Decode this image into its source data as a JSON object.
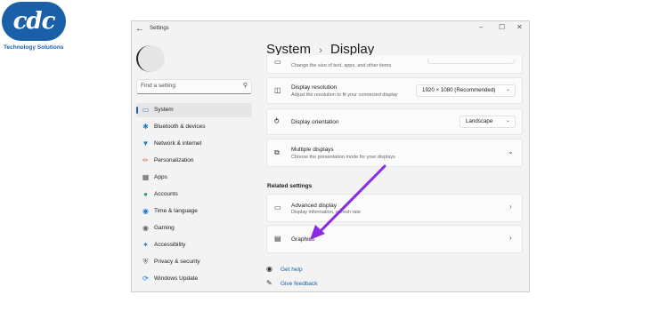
{
  "logo": {
    "mark": "cdc",
    "tagline": "Technology Solutions",
    "color": "#1a5fa8"
  },
  "window": {
    "title": "Settings",
    "controls": [
      "–",
      "☐",
      "✕"
    ]
  },
  "search": {
    "placeholder": "Find a setting",
    "icon": "search-icon"
  },
  "sidebar": {
    "items": [
      {
        "label": "System",
        "icon": "system-icon",
        "selected": true
      },
      {
        "label": "Bluetooth & devices",
        "icon": "bluetooth-icon"
      },
      {
        "label": "Network & internet",
        "icon": "network-icon"
      },
      {
        "label": "Personalization",
        "icon": "brush-icon"
      },
      {
        "label": "Apps",
        "icon": "apps-icon"
      },
      {
        "label": "Accounts",
        "icon": "accounts-icon"
      },
      {
        "label": "Time & language",
        "icon": "globe-icon"
      },
      {
        "label": "Gaming",
        "icon": "gaming-icon"
      },
      {
        "label": "Accessibility",
        "icon": "accessibility-icon"
      },
      {
        "label": "Privacy & security",
        "icon": "shield-icon"
      },
      {
        "label": "Windows Update",
        "icon": "update-icon"
      }
    ]
  },
  "breadcrumb": {
    "parent": "System",
    "separator": "›",
    "current": "Display"
  },
  "settings": {
    "partial_sub": "Change the size of text, apps, and other items",
    "resolution": {
      "title": "Display resolution",
      "sub": "Adjust the resolution to fit your connected display",
      "value": "1920 × 1080 (Recommended)"
    },
    "orientation": {
      "title": "Display orientation",
      "value": "Landscape"
    },
    "multiple": {
      "title": "Multiple displays",
      "sub": "Choose the presentation mode for your displays"
    }
  },
  "related": {
    "heading": "Related settings",
    "advanced": {
      "title": "Advanced display",
      "sub": "Display information, refresh rate"
    },
    "graphics": {
      "title": "Graphics"
    }
  },
  "links": {
    "help": "Get help",
    "feedback": "Give feedback"
  },
  "annotation": {
    "arrow_color": "#8a2be2",
    "points_to": "Graphics"
  }
}
